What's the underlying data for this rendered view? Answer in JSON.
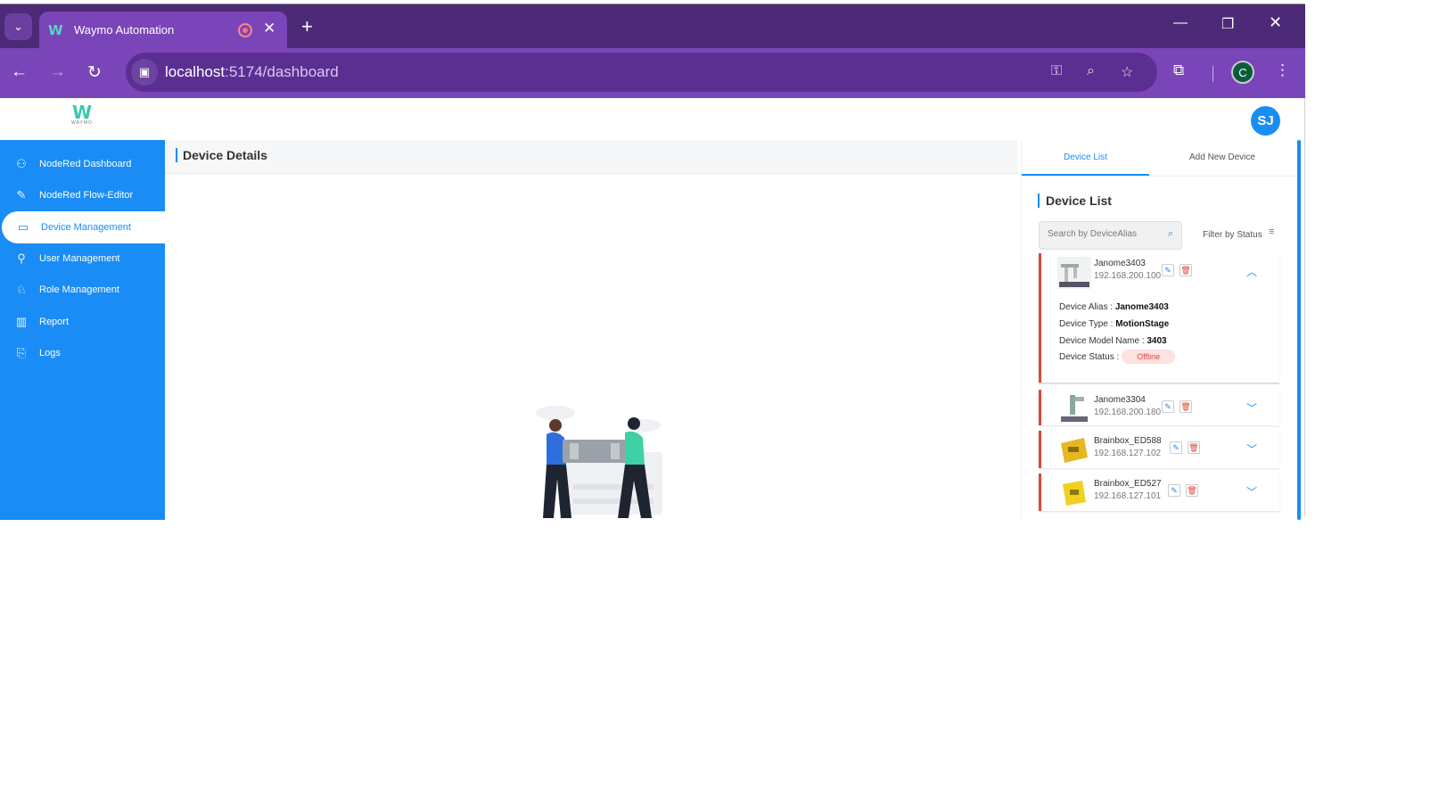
{
  "browser": {
    "tab_title": "Waymo Automation",
    "url_host": "localhost",
    "url_path": ":5174/dashboard",
    "profile_initial": "C"
  },
  "app": {
    "logo_text": "WAYMO",
    "avatar_initials": "SJ"
  },
  "sidebar": {
    "items": [
      {
        "label": "NodeRed Dashboard",
        "icon": "sitemap-icon"
      },
      {
        "label": "NodeRed Flow-Editor",
        "icon": "flow-edit-icon"
      },
      {
        "label": "Device Management",
        "icon": "monitor-icon"
      },
      {
        "label": "User Management",
        "icon": "user-manage-icon"
      },
      {
        "label": "Role Management",
        "icon": "role-icon"
      },
      {
        "label": "Report",
        "icon": "chart-icon"
      },
      {
        "label": "Logs",
        "icon": "logs-icon"
      }
    ],
    "active_index": 2
  },
  "main": {
    "title": "Device Details"
  },
  "right_panel": {
    "tabs": [
      "Device List",
      "Add New Device"
    ],
    "active_tab": 0,
    "list_title": "Device List",
    "search_placeholder": "Search by DeviceAlias",
    "filter_label": "Filter by Status",
    "devices": [
      {
        "name": "Janome3403",
        "ip": "192.168.200.100",
        "expanded": true,
        "details": {
          "alias_label": "Device Alias :",
          "alias": "Janome3403",
          "type_label": "Device Type :",
          "type": "MotionStage",
          "model_label": "Device Model Name :",
          "model": "3403",
          "status_label": "Device Status :",
          "status": "Offline"
        }
      },
      {
        "name": "Janome3304",
        "ip": "192.168.200.180",
        "expanded": false
      },
      {
        "name": "Brainbox_ED588",
        "ip": "192.168.127.102",
        "expanded": false
      },
      {
        "name": "Brainbox_ED527",
        "ip": "192.168.127.101",
        "expanded": false
      }
    ]
  },
  "colors": {
    "primary": "#1a8cf5",
    "browser_frame": "#4c2a78",
    "browser_toolbar": "#7a45b8",
    "alert_red": "#e0463a"
  }
}
